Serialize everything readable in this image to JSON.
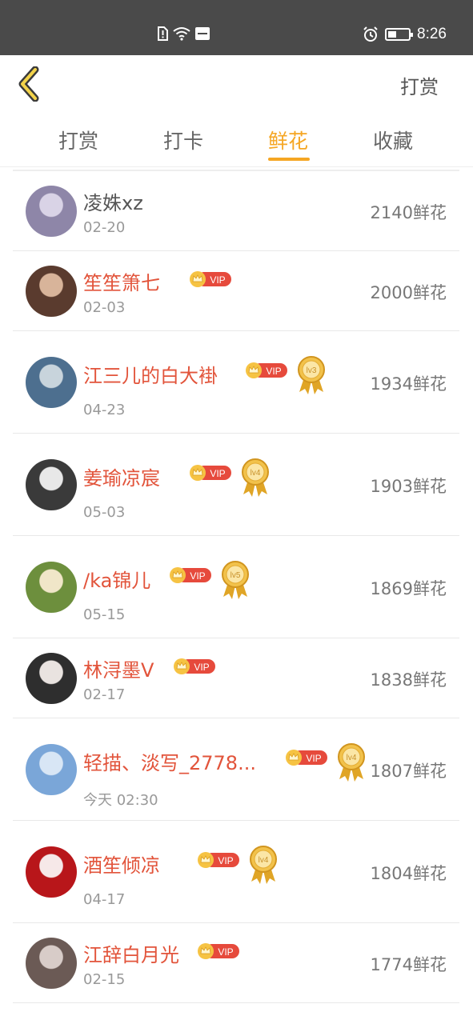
{
  "status_bar": {
    "time": "8:26",
    "battery_level": 0.4
  },
  "header": {
    "back_icon": "chevron-left-icon",
    "action_label": "打赏"
  },
  "tabs": [
    {
      "label": "打赏",
      "active": false
    },
    {
      "label": "打卡",
      "active": false
    },
    {
      "label": "鲜花",
      "active": true
    },
    {
      "label": "收藏",
      "active": false
    }
  ],
  "colors": {
    "accent": "#f5a623",
    "name_red": "#e2543b",
    "vip_red": "#e64a3c",
    "vip_gold": "#f6c343"
  },
  "vip_label": "VIP",
  "list": [
    {
      "name": "凌姝xz",
      "date": "02-20",
      "amount": "2140鲜花",
      "vip": false,
      "level": null
    },
    {
      "name": "笙笙箫七",
      "date": "02-03",
      "amount": "2000鲜花",
      "vip": true,
      "level": null
    },
    {
      "name": "江三儿的白大褂",
      "date": "04-23",
      "amount": "1934鲜花",
      "vip": true,
      "level": "lv3"
    },
    {
      "name": "姜瑜凉宸",
      "date": "05-03",
      "amount": "1903鲜花",
      "vip": true,
      "level": "lv4"
    },
    {
      "name": "/ka锦儿",
      "date": "05-15",
      "amount": "1869鲜花",
      "vip": true,
      "level": "lv5"
    },
    {
      "name": "林浔墨V",
      "date": "02-17",
      "amount": "1838鲜花",
      "vip": true,
      "level": null
    },
    {
      "name": "轻描、淡写_2778...",
      "date": "今天 02:30",
      "amount": "1807鲜花",
      "vip": true,
      "level": "lv4"
    },
    {
      "name": "酒笙倾凉",
      "date": "04-17",
      "amount": "1804鲜花",
      "vip": true,
      "level": "lv4"
    },
    {
      "name": "江辞白月光",
      "date": "02-15",
      "amount": "1774鲜花",
      "vip": true,
      "level": null
    }
  ]
}
